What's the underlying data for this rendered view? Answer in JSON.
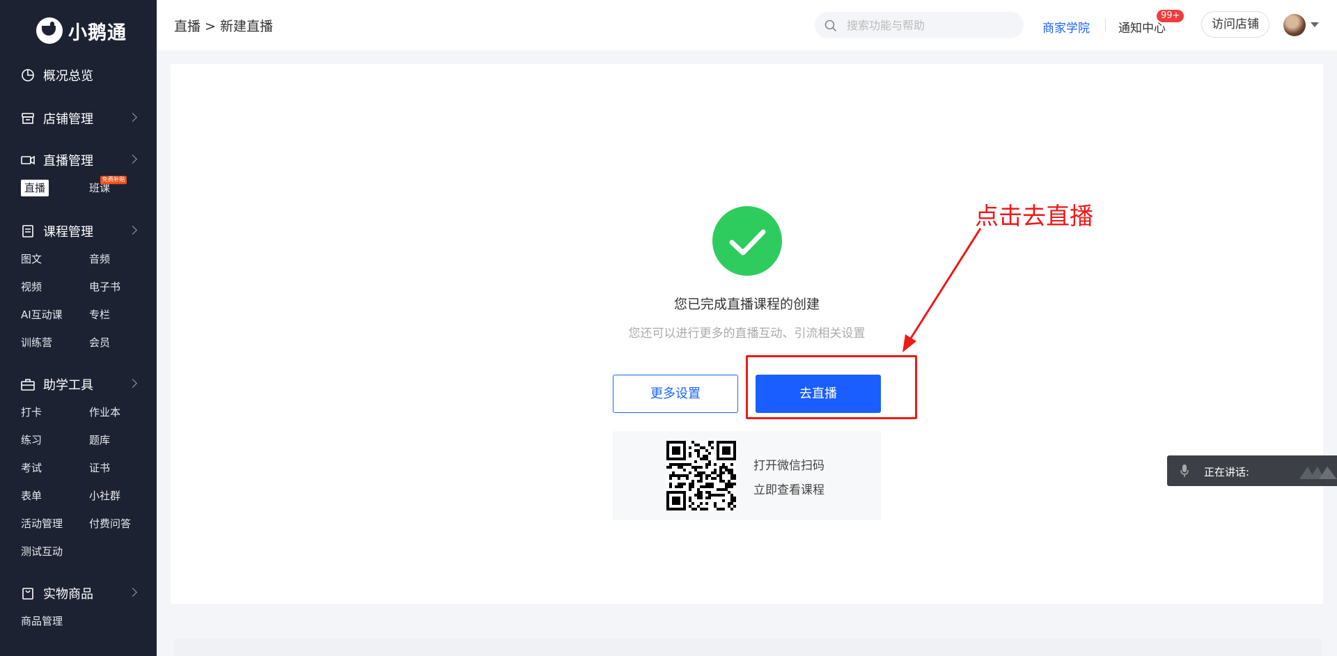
{
  "app": {
    "logo_text": "小鹅通"
  },
  "sidebar": {
    "groups": [
      {
        "label": "概况总览",
        "icon": "pie-chart-icon",
        "has_chevron": false,
        "items": []
      },
      {
        "label": "店铺管理",
        "icon": "store-icon",
        "has_chevron": true,
        "items": []
      },
      {
        "label": "直播管理",
        "icon": "video-camera-icon",
        "has_chevron": true,
        "items": [
          {
            "label": "直播",
            "active": true
          },
          {
            "label": "班课",
            "badge": "免费补贴"
          }
        ]
      },
      {
        "label": "课程管理",
        "icon": "document-icon",
        "has_chevron": true,
        "items": [
          {
            "label": "图文"
          },
          {
            "label": "音频"
          },
          {
            "label": "视频"
          },
          {
            "label": "电子书"
          },
          {
            "label": "AI互动课"
          },
          {
            "label": "专栏"
          },
          {
            "label": "训练营"
          },
          {
            "label": "会员"
          }
        ]
      },
      {
        "label": "助学工具",
        "icon": "toolbox-icon",
        "has_chevron": true,
        "items": [
          {
            "label": "打卡"
          },
          {
            "label": "作业本"
          },
          {
            "label": "练习"
          },
          {
            "label": "题库"
          },
          {
            "label": "考试"
          },
          {
            "label": "证书"
          },
          {
            "label": "表单"
          },
          {
            "label": "小社群"
          },
          {
            "label": "活动管理"
          },
          {
            "label": "付费问答"
          },
          {
            "label": "测试互动"
          }
        ]
      },
      {
        "label": "实物商品",
        "icon": "shopping-bag-icon",
        "has_chevron": true,
        "items": [
          {
            "label": "商品管理"
          }
        ]
      }
    ]
  },
  "header": {
    "breadcrumb": "直播 > 新建直播",
    "search_placeholder": "搜索功能与帮助",
    "academy": "商家学院",
    "notify": "通知中心",
    "notify_badge": "99+",
    "visit_store": "访问店铺"
  },
  "main": {
    "done_title": "您已完成直播课程的创建",
    "done_subtitle": "您还可以进行更多的直播互动、引流相关设置",
    "more_settings": "更多设置",
    "go_live": "去直播",
    "qr_line1": "打开微信扫码",
    "qr_line2": "立即查看课程"
  },
  "annotation": {
    "text": "点击去直播",
    "color": "#f01818"
  },
  "speaking": {
    "label": "正在讲话:"
  },
  "colors": {
    "sidebar_bg": "#1d2233",
    "primary": "#1a5eff",
    "success": "#2ecc5f",
    "badge": "#f23c3c"
  }
}
